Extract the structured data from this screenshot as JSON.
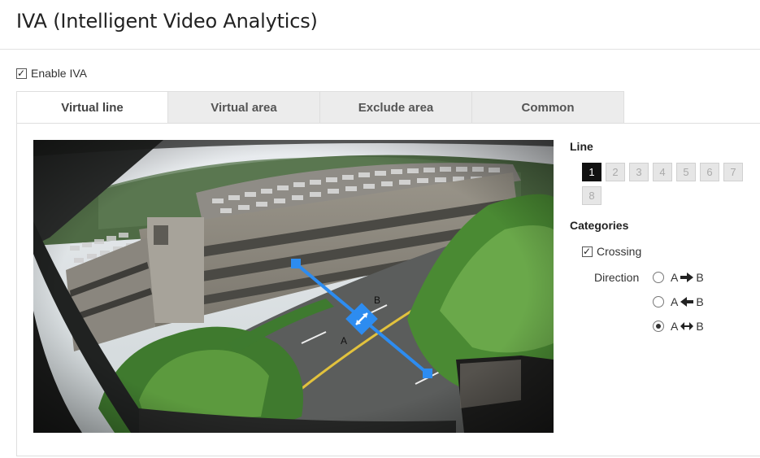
{
  "page": {
    "title": "IVA (Intelligent Video Analytics)"
  },
  "enable": {
    "label": "Enable IVA",
    "checked": true
  },
  "tabs": [
    {
      "label": "Virtual line",
      "active": true
    },
    {
      "label": "Virtual area",
      "active": false
    },
    {
      "label": "Exclude area",
      "active": false
    },
    {
      "label": "Common",
      "active": false
    }
  ],
  "video": {
    "endpoint_a_label": "A",
    "endpoint_b_label": "B",
    "line_color": "#2d8cf0"
  },
  "line_section": {
    "title": "Line",
    "buttons": [
      "1",
      "2",
      "3",
      "4",
      "5",
      "6",
      "7",
      "8"
    ],
    "selected": "1"
  },
  "categories": {
    "title": "Categories",
    "crossing": {
      "label": "Crossing",
      "checked": true
    },
    "direction": {
      "label": "Direction",
      "options": [
        {
          "from": "A",
          "to": "B",
          "arrow": "right-arrow-icon",
          "checked": false
        },
        {
          "from": "A",
          "to": "B",
          "arrow": "left-arrow-icon",
          "checked": false
        },
        {
          "from": "A",
          "to": "B",
          "arrow": "both-arrow-icon",
          "checked": true
        }
      ]
    }
  }
}
